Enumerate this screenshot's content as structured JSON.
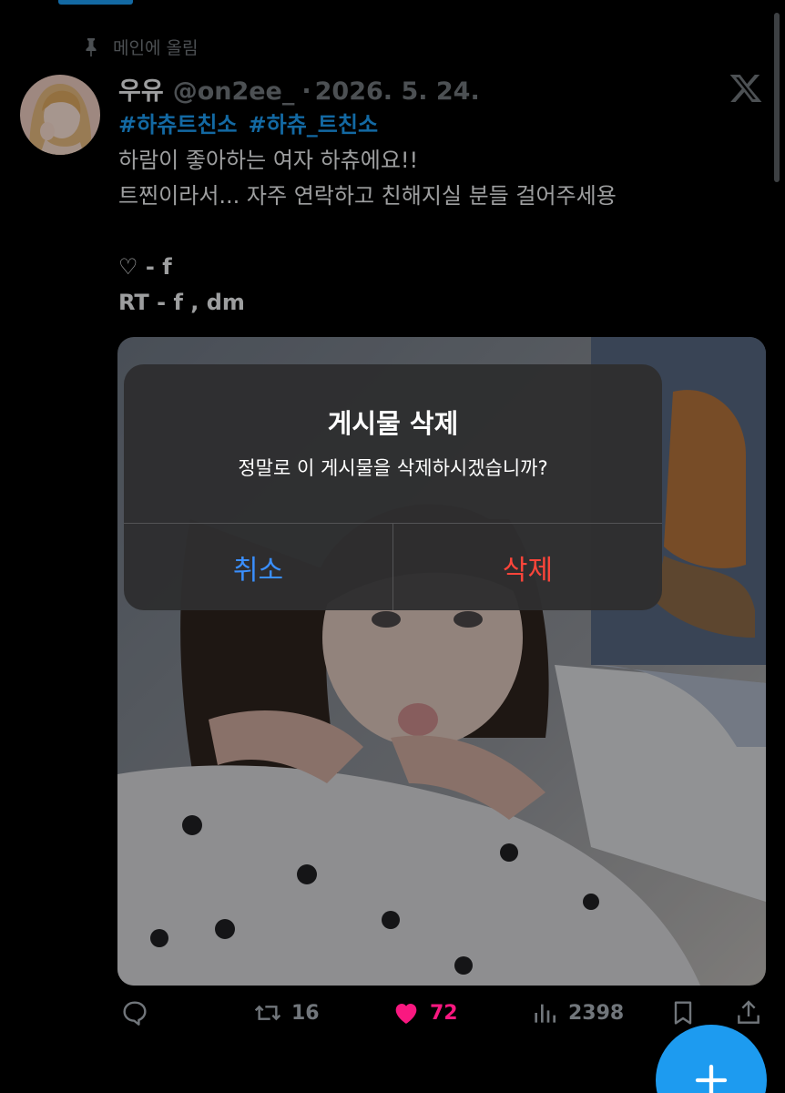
{
  "pinned_label": "메인에 올림",
  "tweet": {
    "display_name": "우유",
    "handle": "@on2ee_",
    "separator": "·",
    "date": "2026. 5. 24.",
    "hashtags": [
      "#하츄트친소",
      "#하츄_트친소"
    ],
    "lines": [
      "하람이 좋아하는 여자 하츄에요!!",
      "트찐이라서... 자주 연락하고 친해지실 분들 걸어주세용"
    ],
    "rules": [
      "♡ - f",
      "RT - f , dm"
    ]
  },
  "alert": {
    "title": "게시물 삭제",
    "message": "정말로 이 게시물을 삭제하시겠습니까?",
    "cancel_label": "취소",
    "delete_label": "삭제"
  },
  "actions": {
    "retweets": "16",
    "likes": "72",
    "views": "2398"
  },
  "colors": {
    "accent": "#1d9bf0",
    "like": "#f91880",
    "cancel": "#3a8fff",
    "destructive": "#ff453a"
  },
  "icons": [
    "pin-icon",
    "x-logo-icon",
    "reply-icon",
    "retweet-icon",
    "heart-icon",
    "views-icon",
    "bookmark-icon",
    "share-icon",
    "plus-icon"
  ]
}
